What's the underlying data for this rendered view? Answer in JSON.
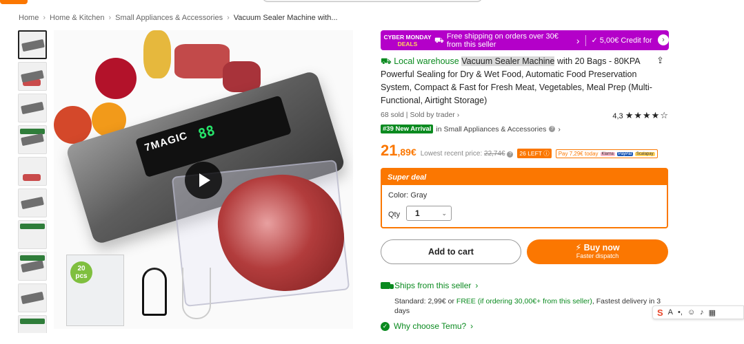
{
  "breadcrumb": {
    "items": [
      "Home",
      "Home & Kitchen",
      "Small Appliances & Accessories",
      "Vacuum Sealer Machine with..."
    ],
    "separator": "›"
  },
  "gallery": {
    "brand_on_device": "7MAGIC",
    "led_display": "88",
    "bags_badge": "20\npcs",
    "thumbnail_count": 10
  },
  "promo": {
    "badge_line1": "CYBER MONDAY",
    "badge_line2": "DEALS",
    "shipping_text": "Free shipping on orders over 30€ from this seller",
    "credit_text": "5,00€ Credit for"
  },
  "product": {
    "warehouse_label": "Local warehouse",
    "title_highlight": "Vacuum Sealer Machine",
    "title_rest": " with 20 Bags - 80KPA Powerful Sealing for Dry & Wet Food, Automatic Food Preservation System, Compact & Fast for Fresh Meat, Vegetables, Meal Prep (Multi-Functional, Airtight Storage)",
    "sold_text": "68 sold",
    "seller_text": "Sold by trader",
    "rating": "4,3",
    "stars": "★★★★☆",
    "rank_badge": "#39 New Arrival",
    "rank_category": "in Small Appliances & Accessories"
  },
  "price": {
    "integer": "21",
    "decimal": ",89€",
    "lowest_label": "Lowest recent price:",
    "lowest_value": "22,74€",
    "left_badge": "26 LEFT",
    "pay_later": "Pay 7,29€ today",
    "pay_logos": [
      "Klarna",
      "PayPal",
      "Scalapay"
    ]
  },
  "deal": {
    "header": "Super deal",
    "color_label": "Color: Gray",
    "qty_label": "Qty",
    "qty_value": "1"
  },
  "buttons": {
    "add_to_cart": "Add to cart",
    "buy_now": "Buy now",
    "buy_now_sub": "Faster dispatch"
  },
  "shipping": {
    "ships_label": "Ships from this seller",
    "standard_prefix": "Standard: 2,99€ or ",
    "free_text": "FREE (if ordering 30,00€+ from this seller)",
    "delivery_text": ", Fastest delivery in 3 days"
  },
  "why": {
    "label": "Why choose Temu?"
  },
  "colors": {
    "accent": "#fb7701",
    "promo": "#b400c9",
    "green": "#0a8a1f"
  }
}
